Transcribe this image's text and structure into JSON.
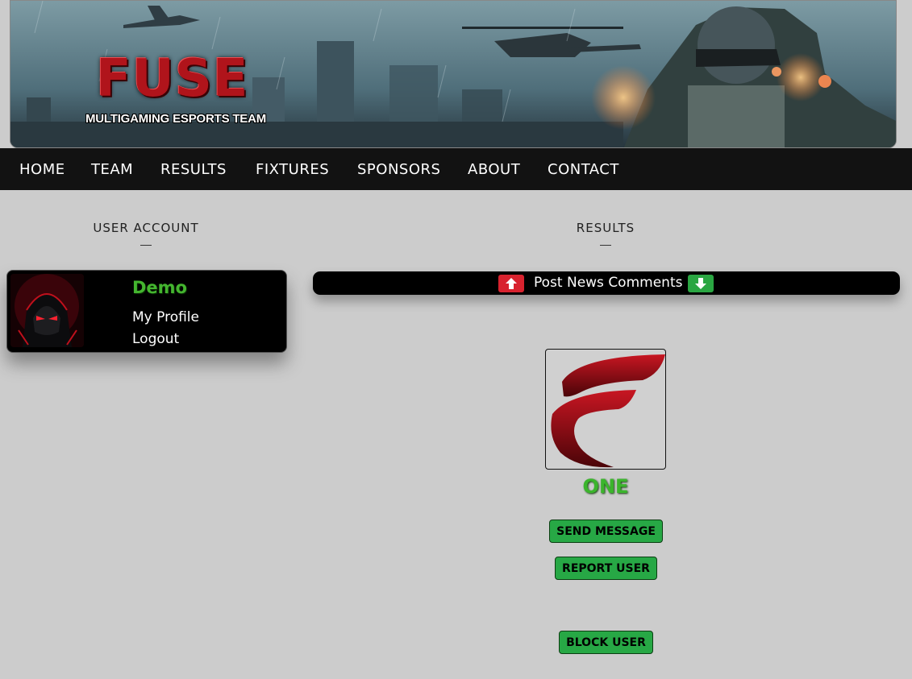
{
  "banner": {
    "logo_text": "FUSE",
    "logo_subtitle": "MULTIGAMING ESPORTS TEAM"
  },
  "nav": {
    "items": [
      "HOME",
      "TEAM",
      "RESULTS",
      "FIXTURES",
      "SPONSORS",
      "ABOUT",
      "CONTACT"
    ]
  },
  "user_account": {
    "title": "USER ACCOUNT",
    "username": "Demo",
    "links": [
      "My Profile",
      "Logout"
    ]
  },
  "results": {
    "title": "RESULTS",
    "bar_label": "Post News Comments",
    "up_icon": "arrow-up-icon",
    "down_icon": "arrow-down-icon"
  },
  "profile": {
    "team_name": "ONE",
    "buttons": [
      "SEND MESSAGE",
      "REPORT USER",
      "BLOCK USER"
    ]
  },
  "colors": {
    "accent_green": "#27a845",
    "username_green": "#44b52f",
    "alert_red": "#d8222e",
    "nav_bg": "#121212",
    "page_bg": "#cccccc"
  }
}
